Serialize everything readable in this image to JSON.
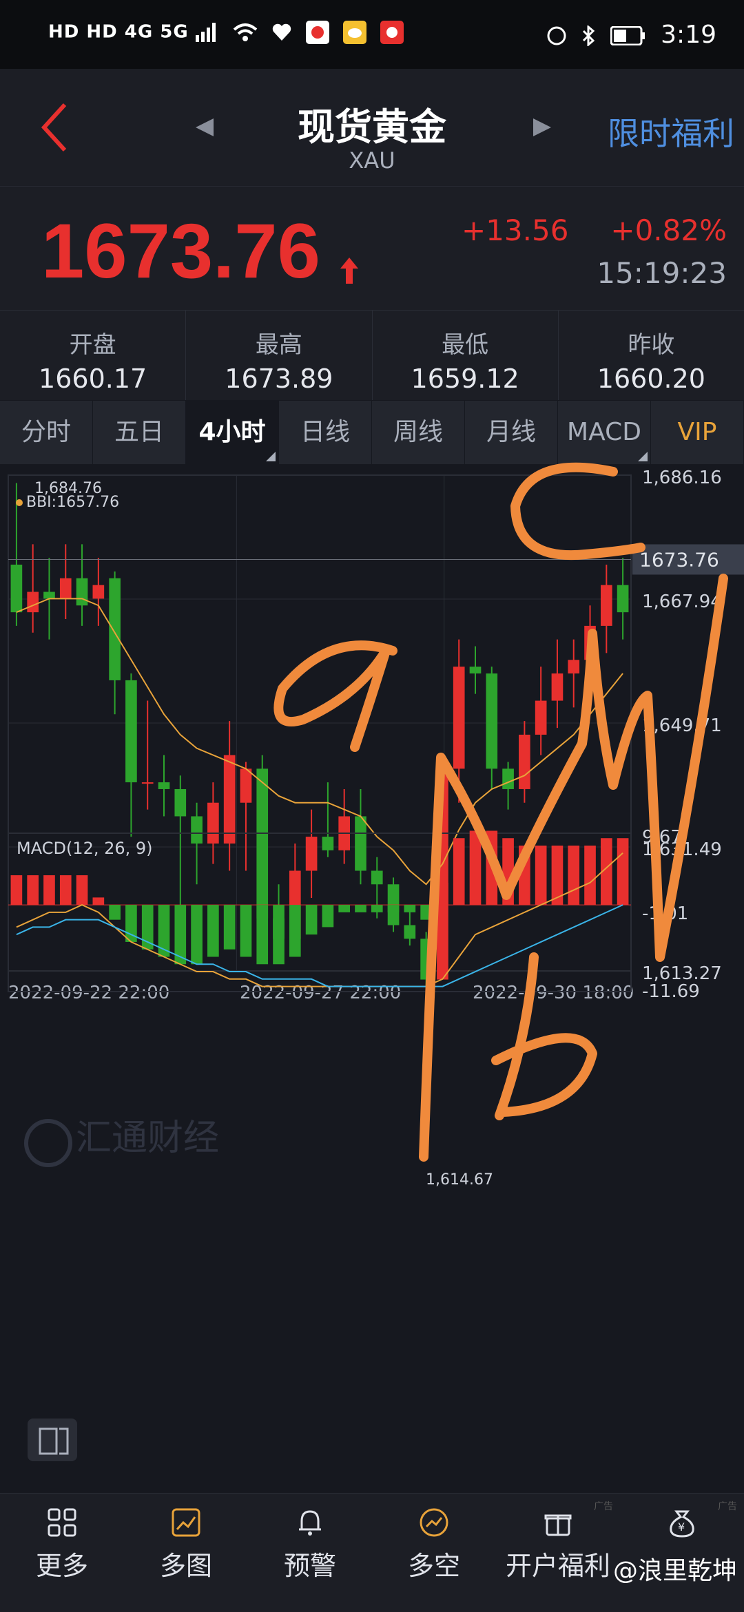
{
  "status_bar": {
    "left": "HD HD 4G 5G",
    "time": "3:19"
  },
  "header": {
    "title": "现货黄金",
    "subtitle": "XAU",
    "promo": "限时福利"
  },
  "quote": {
    "price": "1673.76",
    "change": "+13.56",
    "change_pct": "+0.82%",
    "time": "15:19:23"
  },
  "stats": [
    {
      "label": "开盘",
      "value": "1660.17"
    },
    {
      "label": "最高",
      "value": "1673.89"
    },
    {
      "label": "最低",
      "value": "1659.12"
    },
    {
      "label": "昨收",
      "value": "1660.20"
    }
  ],
  "tabs": [
    "分时",
    "五日",
    "4小时",
    "日线",
    "周线",
    "月线",
    "MACD",
    "VIP"
  ],
  "active_tab": "4小时",
  "chart": {
    "high_mark": "1,684.76",
    "bbi_label": "BBI:1657.76",
    "low_mark": "1,614.67",
    "price_axis": [
      "1,686.16",
      "1,667.94",
      "1,649.71",
      "1,631.49",
      "1,613.27"
    ],
    "current_price_tag": "1673.76",
    "date_labels": [
      "2022-09-22 22:00",
      "2022-09-27 22:00",
      "2022-09-30 18:00"
    ],
    "logo_text": "汇通财经",
    "macd_label": "MACD(12, 26, 9)",
    "macd_axis": [
      "9.67",
      "-1.01",
      "-11.69"
    ],
    "annotations": [
      "a",
      "b",
      "c"
    ]
  },
  "chart_data": {
    "type": "candlestick",
    "ylim": [
      1613.27,
      1686.16
    ],
    "candles": [
      [
        1673,
        1666,
        1685,
        1664
      ],
      [
        1666,
        1669,
        1676,
        1663
      ],
      [
        1669,
        1668,
        1674,
        1662
      ],
      [
        1668,
        1671,
        1676,
        1665
      ],
      [
        1671,
        1667,
        1676,
        1664
      ],
      [
        1668,
        1670,
        1674,
        1664
      ],
      [
        1671,
        1656,
        1672,
        1651
      ],
      [
        1656,
        1641,
        1657,
        1633
      ],
      [
        1641,
        1641,
        1653,
        1637
      ],
      [
        1641,
        1640,
        1645,
        1636
      ],
      [
        1640,
        1636,
        1642,
        1621
      ],
      [
        1636,
        1632,
        1638,
        1626
      ],
      [
        1632,
        1638,
        1641,
        1629
      ],
      [
        1632,
        1645,
        1650,
        1628
      ],
      [
        1638,
        1643,
        1644,
        1628
      ],
      [
        1643,
        1621,
        1645,
        1618
      ],
      [
        1621,
        1618,
        1626,
        1616
      ],
      [
        1618,
        1628,
        1632,
        1618
      ],
      [
        1628,
        1633,
        1637,
        1624
      ],
      [
        1633,
        1631,
        1641,
        1630
      ],
      [
        1631,
        1636,
        1640,
        1629
      ],
      [
        1636,
        1628,
        1640,
        1626
      ],
      [
        1628,
        1626,
        1630,
        1621
      ],
      [
        1626,
        1620,
        1627,
        1619
      ],
      [
        1620,
        1618,
        1622,
        1617
      ],
      [
        1618,
        1612,
        1619,
        1611
      ],
      [
        1612,
        1643,
        1645,
        1614
      ],
      [
        1643,
        1658,
        1662,
        1638
      ],
      [
        1658,
        1657,
        1661,
        1654
      ],
      [
        1657,
        1643,
        1658,
        1640
      ],
      [
        1643,
        1640,
        1644,
        1637
      ],
      [
        1640,
        1648,
        1650,
        1638
      ],
      [
        1648,
        1653,
        1658,
        1645
      ],
      [
        1653,
        1657,
        1662,
        1649
      ],
      [
        1657,
        1659,
        1662,
        1652
      ],
      [
        1659,
        1664,
        1667,
        1655
      ],
      [
        1664,
        1670,
        1673,
        1660
      ],
      [
        1670,
        1666,
        1674,
        1662
      ]
    ],
    "bbi": [
      1666,
      1667,
      1668,
      1668,
      1668,
      1667,
      1663,
      1659,
      1655,
      1651,
      1648,
      1646,
      1645,
      1644,
      1643,
      1641,
      1639,
      1638,
      1638,
      1638,
      1637,
      1636,
      1633,
      1631,
      1628,
      1626,
      1629,
      1634,
      1638,
      1640,
      1641,
      1642,
      1644,
      1646,
      1648,
      1651,
      1654,
      1657
    ],
    "macd_hist": [
      4,
      4,
      4,
      4,
      4,
      1,
      -2,
      -5,
      -6,
      -7,
      -8,
      -8,
      -7,
      -6,
      -7,
      -8,
      -8,
      -7,
      -4,
      -3,
      -1,
      -1,
      -1,
      -1,
      -1,
      -2,
      3,
      9,
      10,
      10,
      9,
      8,
      8,
      8,
      8,
      8,
      9,
      9
    ],
    "dif": [
      -3,
      -2,
      -1,
      -1,
      0,
      -1,
      -3,
      -5,
      -6,
      -7,
      -8,
      -9,
      -9,
      -10,
      -10,
      -11,
      -11,
      -11,
      -11,
      -11,
      -11,
      -11,
      -11,
      -11,
      -11,
      -11,
      -10,
      -7,
      -4,
      -3,
      -2,
      -1,
      0,
      1,
      2,
      3,
      5,
      7
    ],
    "dea": [
      -4,
      -3,
      -3,
      -2,
      -2,
      -2,
      -3,
      -4,
      -5,
      -6,
      -7,
      -8,
      -8,
      -9,
      -9,
      -10,
      -10,
      -10,
      -10,
      -11,
      -11,
      -11,
      -11,
      -11,
      -11,
      -11,
      -11,
      -10,
      -9,
      -8,
      -7,
      -6,
      -5,
      -4,
      -3,
      -2,
      -1,
      0
    ],
    "macd_ylim": [
      -11.69,
      9.67
    ]
  },
  "nav": [
    {
      "label": "更多",
      "icon": "grid-icon"
    },
    {
      "label": "多图",
      "icon": "multi-chart-icon"
    },
    {
      "label": "预警",
      "icon": "bell-icon"
    },
    {
      "label": "多空",
      "icon": "long-short-icon"
    },
    {
      "label": "开户福利",
      "icon": "gift-icon"
    },
    {
      "label": "",
      "icon": "money-bag-icon"
    }
  ],
  "watermark": "@浪里乾坤",
  "colors": {
    "up": "#e8302e",
    "down": "#2da52d",
    "bbi": "#e8a33a",
    "dif": "#e8a33a",
    "dea": "#3ab4e8",
    "promo": "#4f8fe0",
    "annotation": "#f08a3c"
  }
}
